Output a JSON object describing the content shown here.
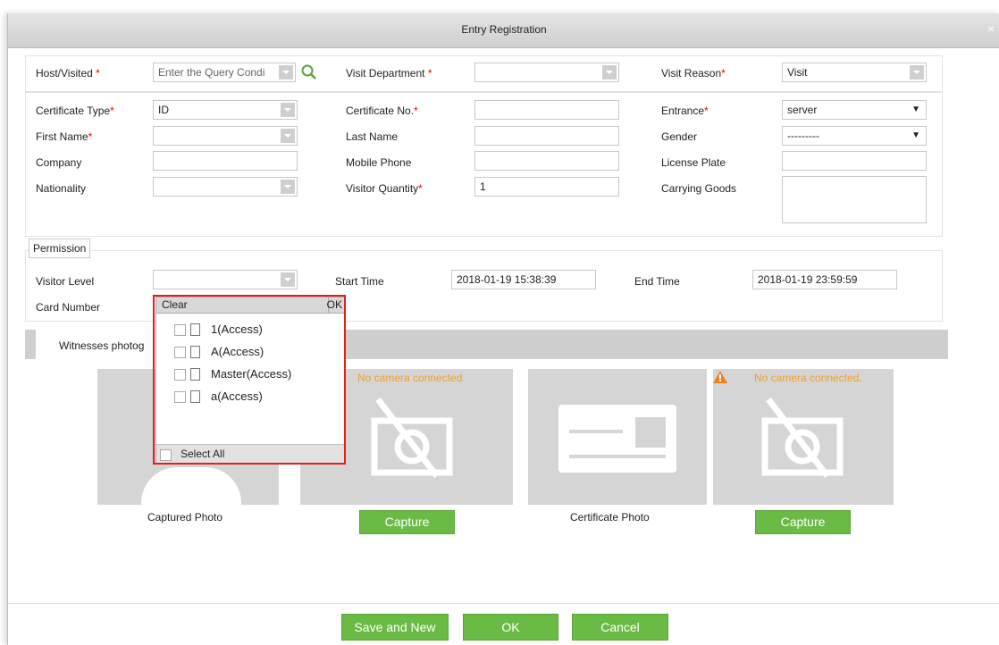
{
  "dialog": {
    "title": "Entry Registration",
    "close": "×"
  },
  "row1": {
    "host_label": "Host/Visited",
    "host_placeholder": "Enter the Query Condi",
    "dept_label": "Visit Department",
    "dept_value": "",
    "reason_label": "Visit Reason",
    "reason_value": "Visit"
  },
  "form": {
    "cert_type_label": "Certificate Type",
    "cert_type_value": "ID",
    "cert_no_label": "Certificate No.",
    "cert_no_value": "",
    "entrance_label": "Entrance",
    "entrance_value": "server",
    "first_name_label": "First Name",
    "first_name_value": "",
    "last_name_label": "Last Name",
    "last_name_value": "",
    "gender_label": "Gender",
    "gender_value": "---------",
    "company_label": "Company",
    "company_value": "",
    "mobile_label": "Mobile Phone",
    "mobile_value": "",
    "plate_label": "License Plate",
    "plate_value": "",
    "nationality_label": "Nationality",
    "nationality_value": "",
    "quantity_label": "Visitor Quantity",
    "quantity_value": "1",
    "goods_label": "Carrying Goods",
    "goods_value": ""
  },
  "permission": {
    "tab_label": "Permission",
    "level_label": "Visitor Level",
    "level_value": "",
    "start_label": "Start Time",
    "start_value": "2018-01-19 15:38:39",
    "end_label": "End Time",
    "end_value": "2018-01-19 23:59:59",
    "card_label": "Card Number"
  },
  "popup": {
    "clear": "Clear",
    "ok": "OK",
    "items": [
      {
        "label": "1(Access)"
      },
      {
        "label": "A(Access)"
      },
      {
        "label": "Master(Access)"
      },
      {
        "label": "a(Access)"
      }
    ],
    "select_all": "Select All"
  },
  "photos": {
    "tab_label": "Witnesses photog",
    "no_camera_1": "No camera connected.",
    "no_camera_2": "No camera connected.",
    "captured_label": "Captured Photo",
    "certificate_label": "Certificate Photo",
    "capture_1": "Capture",
    "capture_2": "Capture"
  },
  "footer": {
    "save_new": "Save and New",
    "ok": "OK",
    "cancel": "Cancel"
  },
  "colors": {
    "accent_green": "#6abb45",
    "warning": "#f0a030",
    "required": "#e00000"
  },
  "icons": [
    "search-icon",
    "close-icon",
    "camera-off-icon",
    "id-card-icon",
    "warning-icon",
    "document-icon"
  ]
}
